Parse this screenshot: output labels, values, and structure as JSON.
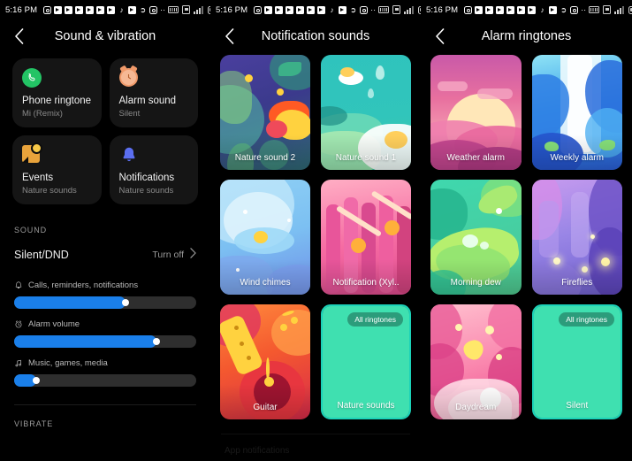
{
  "status_bar": {
    "time": "5:16 PM",
    "left_icons": [
      "instagram-icon",
      "notification-icon",
      "notification-icon",
      "notification-icon",
      "notification-icon",
      "notification-icon",
      "notification-icon",
      "tiktok-icon",
      "app-icon",
      "twitter-icon",
      "whatsapp-icon",
      "more-dots-icon"
    ],
    "right_icons": [
      "nfc-icon",
      "sim-icon",
      "signal-icon",
      "battery-icon"
    ]
  },
  "panel_sound": {
    "title": "Sound & vibration",
    "back": "back-arrow",
    "tiles": [
      {
        "icon": "phone-icon",
        "title": "Phone ringtone",
        "subtitle": "Mi (Remix)"
      },
      {
        "icon": "alarm-clock-icon",
        "title": "Alarm sound",
        "subtitle": "Silent"
      },
      {
        "icon": "calendar-event-icon",
        "title": "Events",
        "subtitle": "Nature sounds"
      },
      {
        "icon": "bell-icon",
        "title": "Notifications",
        "subtitle": "Nature sounds"
      }
    ],
    "section_sound": "SOUND",
    "dnd": {
      "label": "Silent/DND",
      "action": "Turn off"
    },
    "sliders": [
      {
        "icon": "bell-icon",
        "label": "Calls, reminders, notifications",
        "value": 61
      },
      {
        "icon": "alarm-clock-icon",
        "label": "Alarm volume",
        "value": 78
      },
      {
        "icon": "music-note-icon",
        "label": "Music, games, media",
        "value": 10
      }
    ],
    "section_vibrate": "VIBRATE"
  },
  "panel_notification_sounds": {
    "title": "Notification sounds",
    "back": "back-arrow",
    "footer_text": "App notifications",
    "cards": [
      {
        "name": "Nature sound 2",
        "art": "jungle-bird",
        "selected": false,
        "badge": null
      },
      {
        "name": "Nature sound 1",
        "art": "lotus-pond",
        "selected": false,
        "badge": null
      },
      {
        "name": "Wind chimes",
        "art": "wind-chimes",
        "selected": false,
        "badge": null
      },
      {
        "name": "Notification (Xyl..",
        "art": "xylophone",
        "selected": false,
        "badge": null
      },
      {
        "name": "Guitar",
        "art": "guitar",
        "selected": false,
        "badge": null
      },
      {
        "name": "Nature sounds",
        "art": "plain-mint",
        "selected": true,
        "badge": "All ringtones"
      }
    ]
  },
  "panel_alarm_ringtones": {
    "title": "Alarm ringtones",
    "back": "back-arrow",
    "cards": [
      {
        "name": "Weather alarm",
        "art": "sunset",
        "selected": false,
        "badge": null
      },
      {
        "name": "Weekly alarm",
        "art": "waterfall",
        "selected": false,
        "badge": null
      },
      {
        "name": "Morning dew",
        "art": "dew-leaf",
        "selected": false,
        "badge": null
      },
      {
        "name": "Fireflies",
        "art": "fireflies",
        "selected": false,
        "badge": null
      },
      {
        "name": "Daydream",
        "art": "daydream",
        "selected": false,
        "badge": null
      },
      {
        "name": "Silent",
        "art": "plain-mint",
        "selected": true,
        "badge": "All ringtones"
      }
    ]
  },
  "colors": {
    "accent_blue": "#1a7fea",
    "selected_mint": "#3fe0b0",
    "selected_border": "#1cd2b8",
    "background": "#000000",
    "tile_bg": "#151515"
  }
}
